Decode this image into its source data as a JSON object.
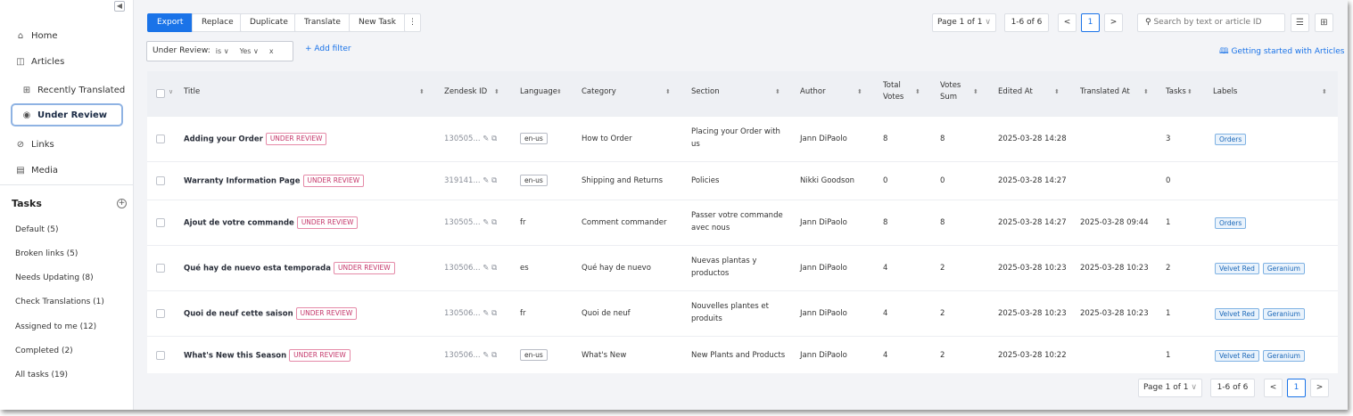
{
  "sidebar": {
    "collapse_icon": "◀",
    "nav": [
      {
        "label": "Home",
        "icon": "⌂"
      },
      {
        "label": "Articles",
        "icon": "◫"
      },
      {
        "label": "Recently Translated",
        "icon": "⊞"
      },
      {
        "label": "Under Review",
        "icon": "◉"
      },
      {
        "label": "Links",
        "icon": "⊘"
      },
      {
        "label": "Media",
        "icon": "▤"
      }
    ],
    "tasks_title": "Tasks",
    "tasks": [
      "Default (5)",
      "Broken links (5)",
      "Needs Updating (8)",
      "Check Translations (1)",
      "Assigned to me (12)",
      "Completed (2)",
      "All tasks (19)"
    ]
  },
  "toolbar": {
    "export": "Export",
    "replace": "Replace",
    "duplicate": "Duplicate",
    "translate": "Translate",
    "new_task": "New Task",
    "more": "⋮",
    "page_select": "Page 1 of 1",
    "range": "1-6 of 6",
    "prev": "<",
    "current_page": "1",
    "next": ">",
    "search_placeholder": "Search by text or article ID"
  },
  "filter": {
    "field": "Under Review:",
    "operator": "is",
    "value": "Yes",
    "clear": "x",
    "add_filter": "+ Add filter",
    "getting_started": "Getting started with Articles"
  },
  "table": {
    "headers": {
      "title": "Title",
      "zendesk_id": "Zendesk ID",
      "language": "Language",
      "category": "Category",
      "section": "Section",
      "author": "Author",
      "total_votes_1": "Total",
      "total_votes_2": "Votes",
      "votes_sum_1": "Votes",
      "votes_sum_2": "Sum",
      "edited_at": "Edited At",
      "translated_at": "Translated At",
      "tasks": "Tasks",
      "labels": "Labels"
    },
    "badge": "UNDER REVIEW",
    "rows": [
      {
        "title": "Adding your Order",
        "zid": "130505...",
        "lang": "en-us",
        "lang_chip": true,
        "category": "How to Order",
        "section_1": "Placing your Order with",
        "section_2": "us",
        "author": "Jann DiPaolo",
        "total_votes": "8",
        "votes_sum": "8",
        "edited_at": "2025-03-28 14:28",
        "translated_at": "",
        "tasks": "3",
        "labels": [
          "Orders"
        ]
      },
      {
        "title": "Warranty Information Page",
        "zid": "319141...",
        "lang": "en-us",
        "lang_chip": true,
        "category": "Shipping and Returns",
        "section_1": "Policies",
        "section_2": "",
        "author": "Nikki Goodson",
        "total_votes": "0",
        "votes_sum": "0",
        "edited_at": "2025-03-28 14:27",
        "translated_at": "",
        "tasks": "0",
        "labels": []
      },
      {
        "title": "Ajout de votre commande",
        "zid": "130505...",
        "lang": "fr",
        "lang_chip": false,
        "category": "Comment commander",
        "section_1": "Passer votre commande",
        "section_2": "avec nous",
        "author": "Jann DiPaolo",
        "total_votes": "8",
        "votes_sum": "8",
        "edited_at": "2025-03-28 14:27",
        "translated_at": "2025-03-28 09:44",
        "tasks": "1",
        "labels": [
          "Orders"
        ]
      },
      {
        "title": "Qué hay de nuevo esta temporada",
        "zid": "130506...",
        "lang": "es",
        "lang_chip": false,
        "category": "Qué hay de nuevo",
        "section_1": "Nuevas plantas y",
        "section_2": "productos",
        "author": "Jann DiPaolo",
        "total_votes": "4",
        "votes_sum": "2",
        "edited_at": "2025-03-28 10:23",
        "translated_at": "2025-03-28 10:23",
        "tasks": "2",
        "labels": [
          "Velvet Red",
          "Geranium"
        ]
      },
      {
        "title": "Quoi de neuf cette saison",
        "zid": "130506...",
        "lang": "fr",
        "lang_chip": false,
        "category": "Quoi de neuf",
        "section_1": "Nouvelles plantes et",
        "section_2": "produits",
        "author": "Jann DiPaolo",
        "total_votes": "4",
        "votes_sum": "2",
        "edited_at": "2025-03-28 10:23",
        "translated_at": "2025-03-28 10:23",
        "tasks": "1",
        "labels": [
          "Velvet Red",
          "Geranium"
        ]
      },
      {
        "title": "What's New this Season",
        "zid": "130506...",
        "lang": "en-us",
        "lang_chip": true,
        "category": "What's New",
        "section_1": "New Plants and Products",
        "section_2": "",
        "author": "Jann DiPaolo",
        "total_votes": "4",
        "votes_sum": "2",
        "edited_at": "2025-03-28 10:22",
        "translated_at": "",
        "tasks": "1",
        "labels": [
          "Velvet Red",
          "Geranium"
        ]
      }
    ]
  },
  "bottom_pager": {
    "page_select": "Page 1 of 1",
    "range": "1-6 of 6",
    "prev": "<",
    "current_page": "1",
    "next": ">"
  },
  "colors": {
    "accent": "#1a73e8",
    "badge": "#c4376a",
    "label": "#1a67b8"
  }
}
